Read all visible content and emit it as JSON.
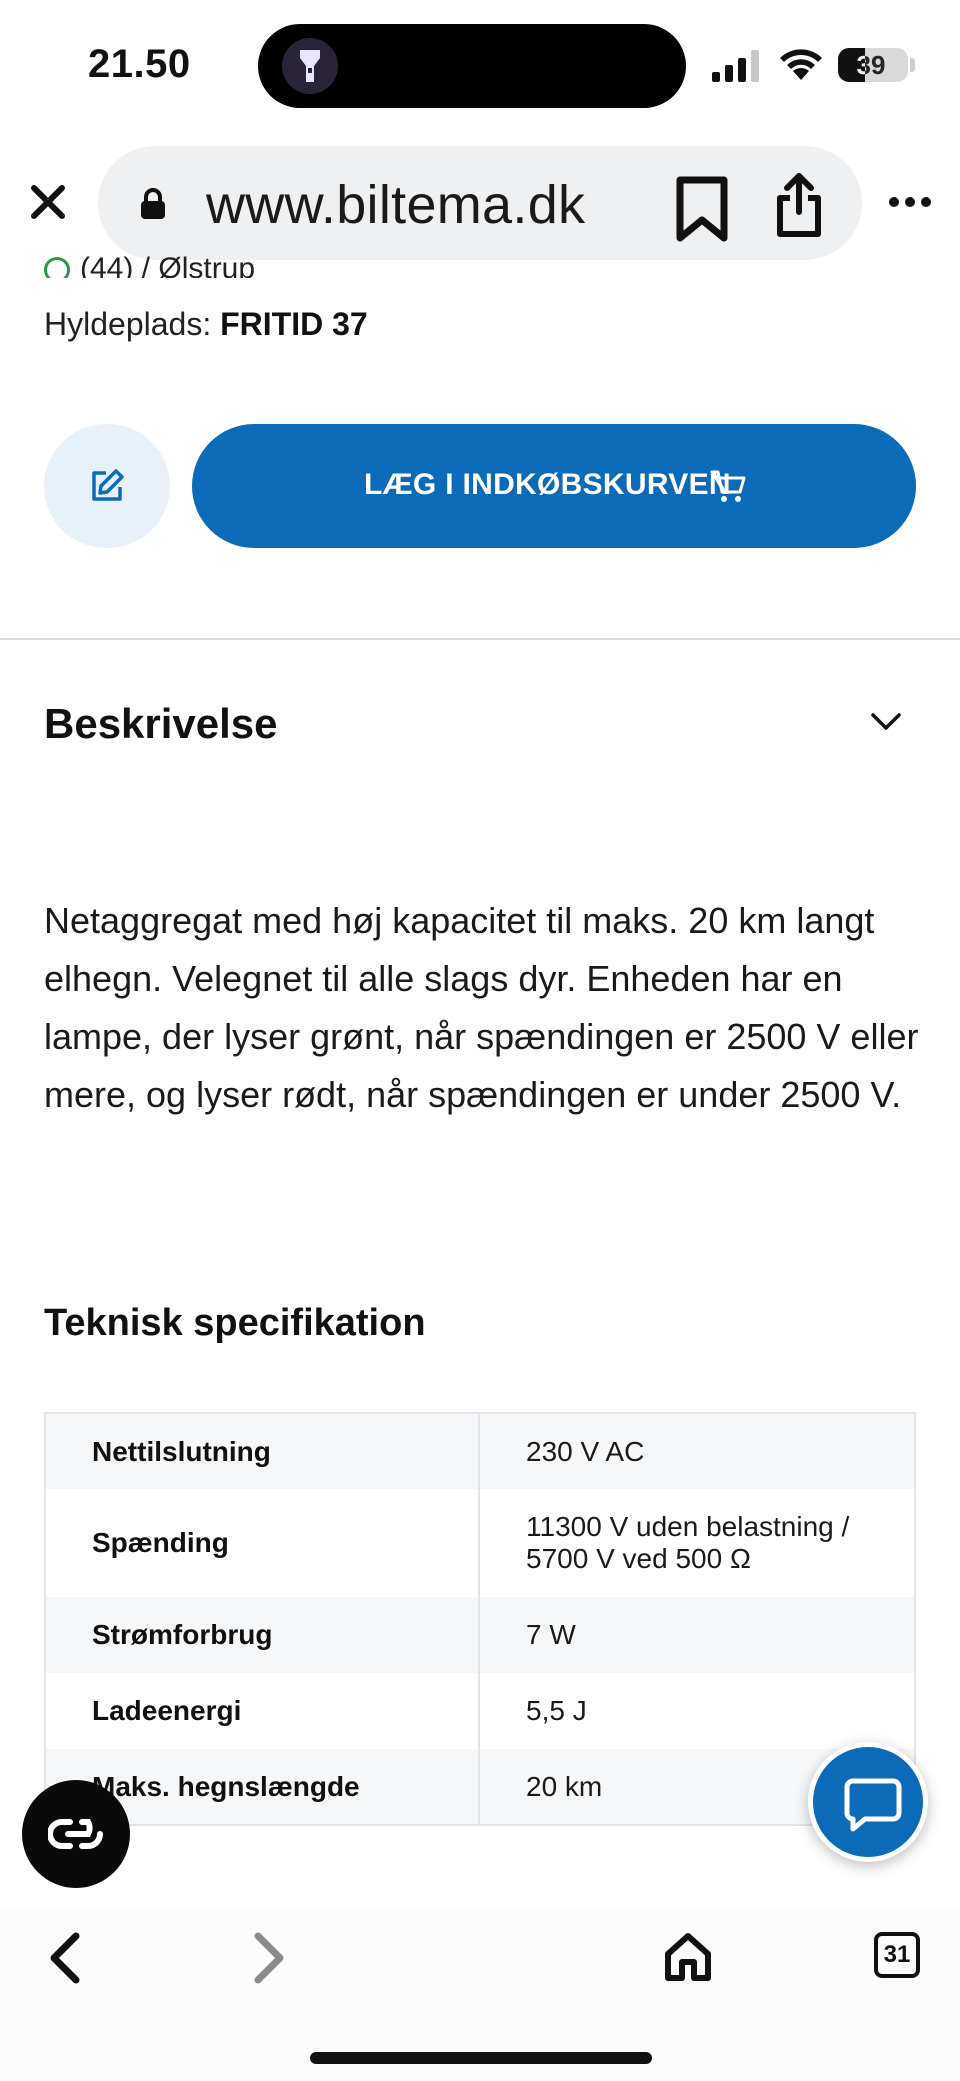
{
  "status_bar": {
    "time": "21.50",
    "battery_percent": "39",
    "battery_level": 0.39
  },
  "browser": {
    "url": "www.biltema.dk",
    "tab_count": "31"
  },
  "product": {
    "partial_stock_text": "(44) / Ølstrup",
    "shelf_label": "Hyldeplads:",
    "shelf_value": "FRITID 37",
    "add_to_cart_label": "LÆG I INDKØBSKURVEN"
  },
  "description": {
    "title": "Beskrivelse",
    "text": "Netaggregat med høj kapacitet til maks. 20 km langt elhegn. Velegnet til alle slags dyr. Enheden har en lampe, der lyser grønt, når spændingen er 2500 V eller mere, og lyser rødt, når spændingen er under 2500 V."
  },
  "specs": {
    "title": "Teknisk specifikation",
    "rows": [
      {
        "key": "Nettilslutning",
        "value": "230 V AC"
      },
      {
        "key": "Spænding",
        "value": "11300 V uden belastning / 5700 V ved 500 Ω"
      },
      {
        "key": "Strømforbrug",
        "value": "7 W"
      },
      {
        "key": "Ladeenergi",
        "value": "5,5 J"
      },
      {
        "key": "Maks. hegnslængde",
        "value": "20 km"
      }
    ]
  },
  "colors": {
    "brand_blue": "#0b6bb8",
    "edit_bg": "#e6f1f9",
    "stock_green": "#2e9a3a"
  },
  "icons": {
    "close": "close-icon",
    "lock": "lock-icon",
    "bookmark": "bookmark-icon",
    "share": "share-icon",
    "more": "more-icon",
    "edit": "edit-icon",
    "cart": "cart-icon",
    "chevron": "chevron-down-icon",
    "chat": "chat-icon",
    "reader": "reader-icon",
    "back": "back-icon",
    "forward": "forward-icon",
    "home": "home-icon"
  }
}
